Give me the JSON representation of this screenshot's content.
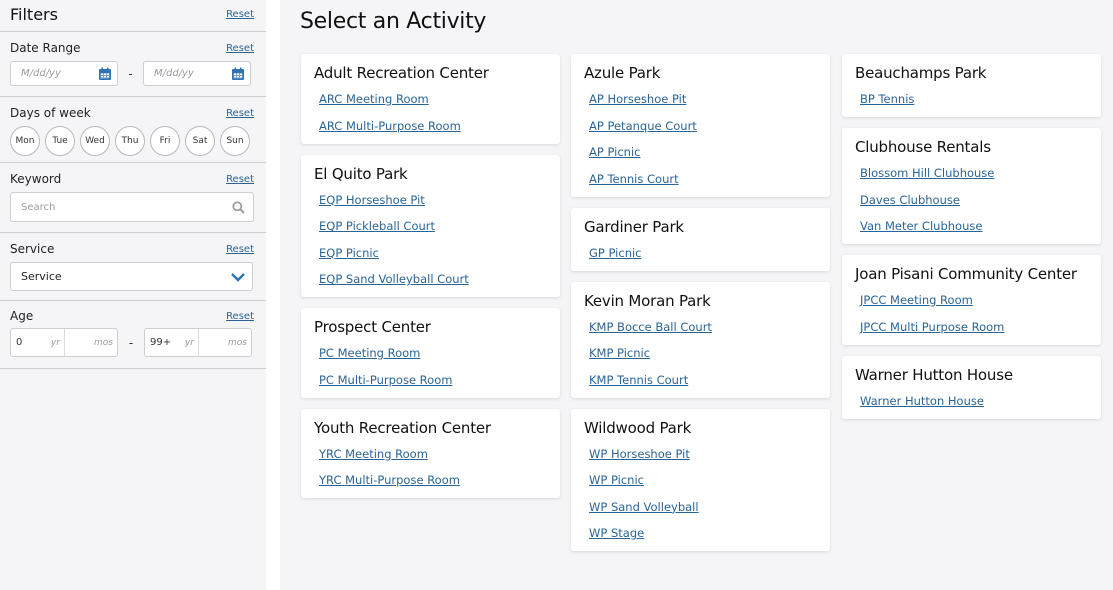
{
  "sidebar": {
    "title": "Filters",
    "reset_label": "Reset",
    "date_range": {
      "label": "Date Range",
      "reset_label": "Reset",
      "start_placeholder": "M/dd/yy",
      "end_placeholder": "M/dd/yy",
      "separator": "-",
      "icon": "calendar-icon"
    },
    "days_of_week": {
      "label": "Days of week",
      "reset_label": "Reset",
      "days": [
        "Mon",
        "Tue",
        "Wed",
        "Thu",
        "Fri",
        "Sat",
        "Sun"
      ]
    },
    "keyword": {
      "label": "Keyword",
      "reset_label": "Reset",
      "placeholder": "Search",
      "icon": "search-icon"
    },
    "service": {
      "label": "Service",
      "reset_label": "Reset",
      "selected": "Service",
      "icon": "chevron-down-icon"
    },
    "age": {
      "label": "Age",
      "reset_label": "Reset",
      "min_years": "0",
      "max_years": "99+",
      "yr_unit": "yr",
      "mos_unit": "mos",
      "separator": "-"
    }
  },
  "main": {
    "title": "Select an Activity",
    "columns": [
      [
        {
          "title": "Adult Recreation Center",
          "links": [
            "ARC Meeting Room",
            "ARC Multi-Purpose Room"
          ]
        },
        {
          "title": "El Quito Park",
          "links": [
            "EQP Horseshoe Pit",
            "EQP Pickleball Court",
            "EQP Picnic",
            "EQP Sand Volleyball Court"
          ]
        },
        {
          "title": "Prospect Center",
          "links": [
            "PC Meeting Room",
            "PC Multi-Purpose Room"
          ]
        },
        {
          "title": "Youth Recreation Center",
          "links": [
            "YRC Meeting Room",
            "YRC Multi-Purpose Room"
          ]
        }
      ],
      [
        {
          "title": "Azule Park",
          "links": [
            "AP Horseshoe Pit",
            "AP Petanque Court",
            "AP Picnic",
            "AP Tennis Court"
          ]
        },
        {
          "title": "Gardiner Park",
          "links": [
            "GP Picnic"
          ]
        },
        {
          "title": "Kevin Moran Park",
          "links": [
            "KMP Bocce Ball Court",
            "KMP Picnic",
            "KMP Tennis Court"
          ]
        },
        {
          "title": "Wildwood Park",
          "links": [
            "WP Horseshoe Pit",
            "WP Picnic",
            "WP Sand Volleyball",
            "WP Stage"
          ]
        }
      ],
      [
        {
          "title": "Beauchamps Park",
          "links": [
            "BP Tennis"
          ]
        },
        {
          "title": "Clubhouse Rentals",
          "links": [
            "Blossom Hill Clubhouse",
            "Daves Clubhouse",
            "Van Meter Clubhouse"
          ]
        },
        {
          "title": "Joan Pisani Community Center",
          "links": [
            "JPCC Meeting Room",
            "JPCC Multi Purpose Room"
          ]
        },
        {
          "title": "Warner Hutton House",
          "links": [
            "Warner Hutton House"
          ]
        }
      ]
    ]
  },
  "colors": {
    "link": "#2a6496",
    "icon_blue": "#2f73b3",
    "background": "#f5f5f8",
    "card": "#ffffff"
  }
}
